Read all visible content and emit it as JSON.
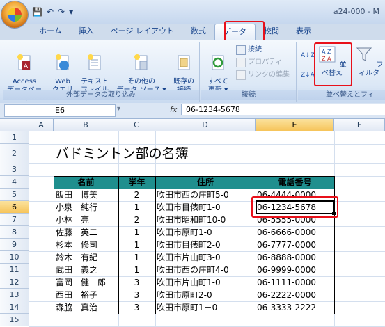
{
  "window": {
    "title": "a24-000 - M"
  },
  "qat": {
    "save": "💾",
    "undo": "↶",
    "redo": "↷",
    "more": "▾"
  },
  "tabs": [
    {
      "label": "ホーム"
    },
    {
      "label": "挿入"
    },
    {
      "label": "ページ レイアウト"
    },
    {
      "label": "数式"
    },
    {
      "label": "データ"
    },
    {
      "label": "校閲"
    },
    {
      "label": "表示"
    }
  ],
  "ribbon": {
    "external": {
      "label": "外部データの取り込み",
      "access": "Access\nデータベース",
      "web": "Web\nクエリ",
      "text": "テキスト\nファイル",
      "other": "その他の\nデータ ソース ▾",
      "existing": "既存の\n接続"
    },
    "connections": {
      "label": "接続",
      "refresh": "すべて\n更新 ▾",
      "connect": "接続",
      "properties": "プロパティ",
      "edit_links": "リンクの編集"
    },
    "sort": {
      "label": "並べ替えとフィ",
      "sort": "並べ替え",
      "filter": "フィルタ"
    }
  },
  "formula_bar": {
    "name_box": "E6",
    "fx": "fx",
    "content": "06-1234-5678"
  },
  "columns": [
    "A",
    "B",
    "C",
    "D",
    "E",
    "F"
  ],
  "rows": [
    "1",
    "2",
    "3",
    "4",
    "5",
    "6",
    "7",
    "8",
    "9",
    "10",
    "11",
    "12",
    "13",
    "14",
    "15"
  ],
  "sheet": {
    "title": "バドミントン部の名簿",
    "headers": [
      "名前",
      "学年",
      "住所",
      "電話番号"
    ],
    "records": [
      [
        "飯田　博美",
        "2",
        "吹田市西の庄町5-0",
        "06-4444-0000"
      ],
      [
        "小泉　純行",
        "1",
        "吹田市目俵町1-0",
        "06-1234-5678"
      ],
      [
        "小林　亮",
        "2",
        "吹田市昭和町10-0",
        "06-5555-0000"
      ],
      [
        "佐藤　英二",
        "1",
        "吹田市原町1-0",
        "06-6666-0000"
      ],
      [
        "杉本　修司",
        "1",
        "吹田市目俵町2-0",
        "06-7777-0000"
      ],
      [
        "鈴木　有紀",
        "1",
        "吹田市片山町3-0",
        "06-8888-0000"
      ],
      [
        "武田　義之",
        "1",
        "吹田市西の庄町4-0",
        "06-9999-0000"
      ],
      [
        "富岡　健一郎",
        "3",
        "吹田市片山町1-0",
        "06-1111-0000"
      ],
      [
        "西田　裕子",
        "3",
        "吹田市原町2-0",
        "06-2222-0000"
      ],
      [
        "森脇　真治",
        "3",
        "吹田市原町1－0",
        "06-3333-2222"
      ]
    ]
  },
  "colors": {
    "highlight": "#e8101a",
    "selection": "#f6c45a"
  }
}
